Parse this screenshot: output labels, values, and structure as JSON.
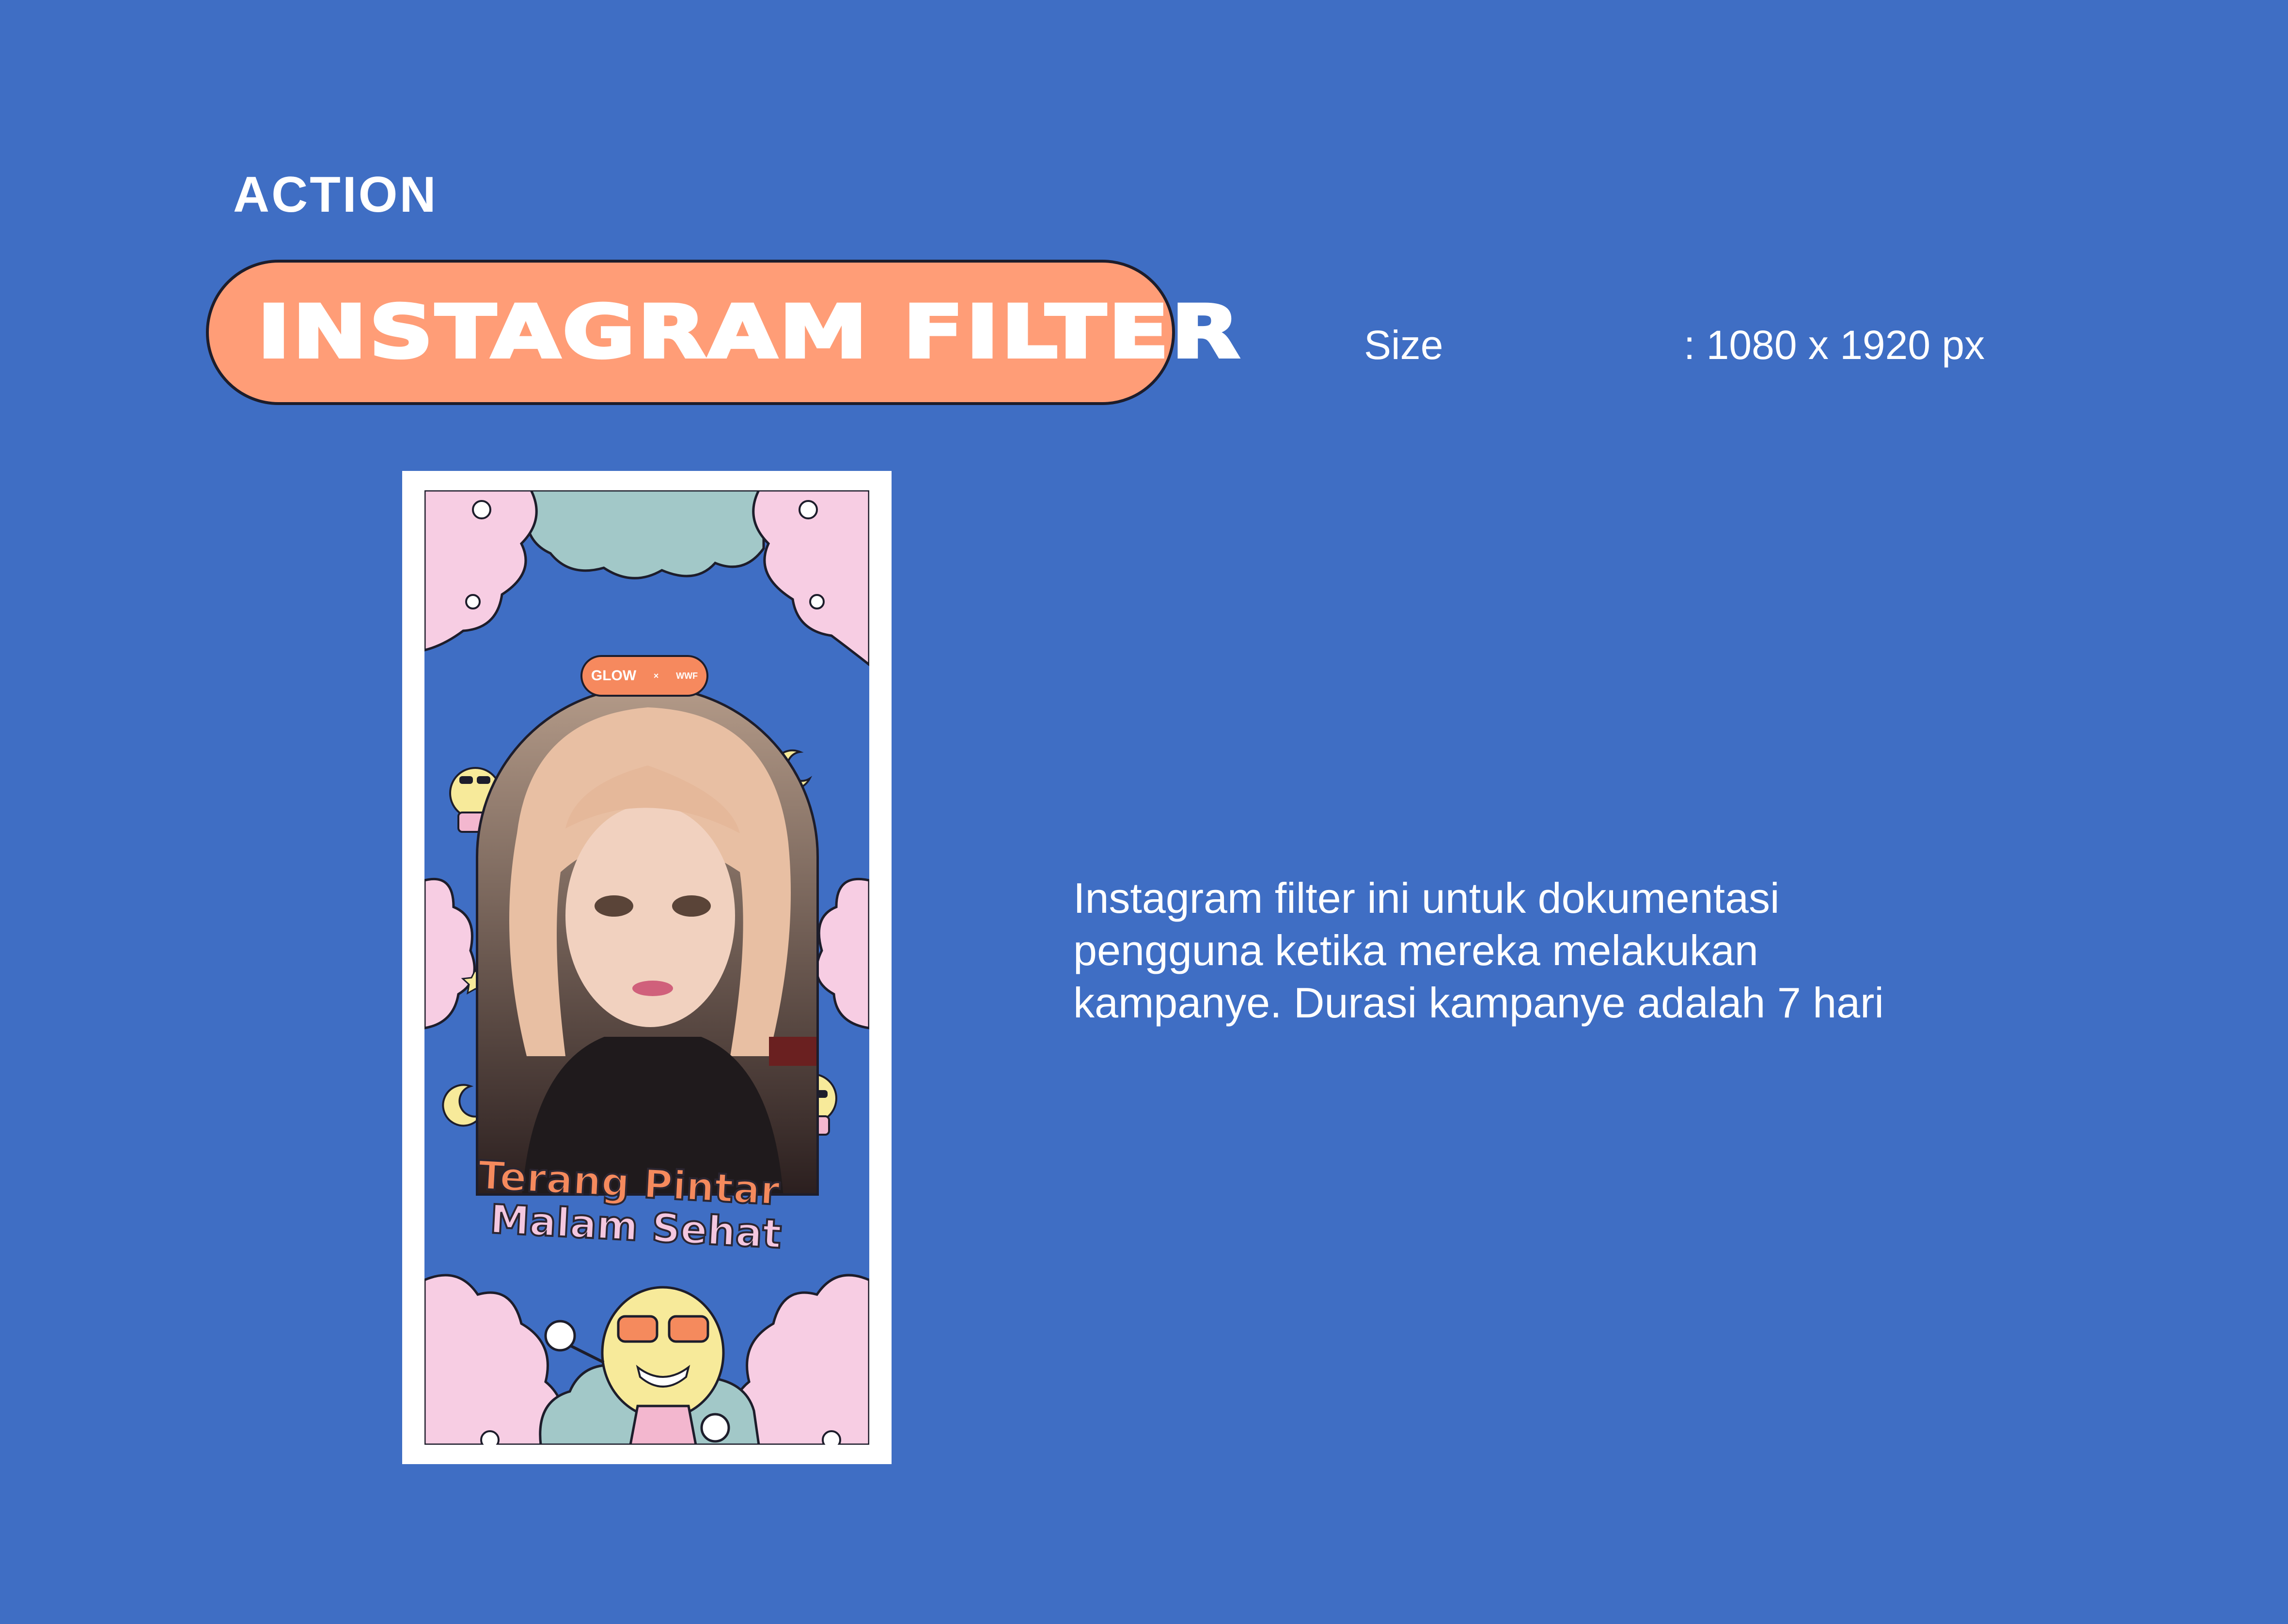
{
  "header": {
    "section_label": "ACTION",
    "title": "INSTAGRAM FILTER"
  },
  "spec": {
    "label": "Size",
    "value": ": 1080 x 1920 px"
  },
  "description": {
    "lines": [
      "Instagram filter ini untuk dokumentasi",
      "pengguna ketika mereka melakukan",
      "kampanye. Durasi kampanye adalah 7 hari"
    ]
  },
  "filter_preview": {
    "badge_brand": "GLOW",
    "badge_x": "×",
    "badge_partner": "WWF",
    "tagline_line1": "Terang Pintar",
    "tagline_line2": "Malam Sehat"
  },
  "colors": {
    "background": "#3f6ec4",
    "accent": "#ff9d77",
    "cloud_pink": "#f7cde3",
    "cloud_teal": "#a2c8c8",
    "mascot_yellow": "#f7ea9a"
  }
}
